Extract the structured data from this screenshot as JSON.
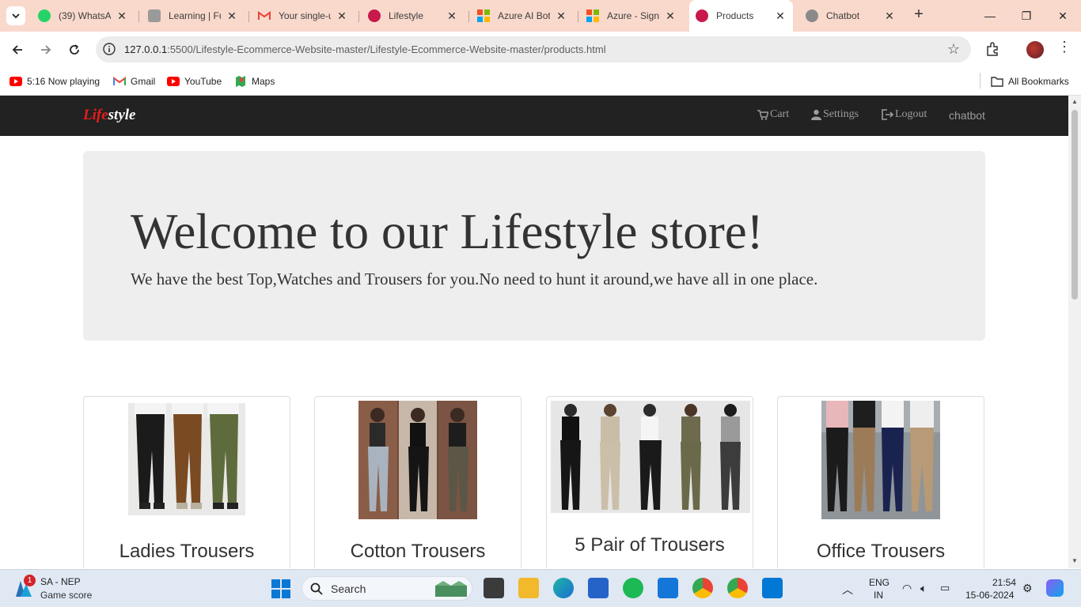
{
  "tabs": [
    {
      "title": "(39) WhatsApp",
      "icon": "whatsapp-icon",
      "color": "#25d366"
    },
    {
      "title": "Learning | Fu",
      "icon": "learning-icon",
      "color": "#8a8a8a"
    },
    {
      "title": "Your single-u",
      "icon": "gmail-icon",
      "color": "#ea4335"
    },
    {
      "title": "Lifestyle",
      "icon": "lifestyle-icon",
      "color": "#c9184a"
    },
    {
      "title": "Azure AI Bot",
      "icon": "microsoft-icon",
      "color": "#f25022"
    },
    {
      "title": "Azure - Sign",
      "icon": "microsoft-icon",
      "color": "#f25022"
    },
    {
      "title": "Products",
      "icon": "lifestyle-icon",
      "color": "#c9184a"
    },
    {
      "title": "Chatbot",
      "icon": "globe-icon",
      "color": "#777777"
    }
  ],
  "address": {
    "host": "127.0.0.1",
    "path": ":5500/Lifestyle-Ecommerce-Website-master/Lifestyle-Ecommerce-Website-master/products.html"
  },
  "bookmarks": {
    "items": [
      "5:16 Now playing",
      "Gmail",
      "YouTube",
      "Maps"
    ],
    "all": "All Bookmarks"
  },
  "site": {
    "brand_a": "Life",
    "brand_b": "style",
    "nav": [
      "Cart",
      "Settings",
      "Logout",
      "chatbot"
    ]
  },
  "hero": {
    "title": "Welcome to our Lifestyle store!",
    "subtitle": "We have the best Top,Watches and Trousers for you.No need to hunt it around,we have all in one place."
  },
  "products": [
    {
      "name": "Ladies Trousers"
    },
    {
      "name": "Cotton Trousers"
    },
    {
      "name": "5 Pair of Trousers"
    },
    {
      "name": "Office Trousers"
    }
  ],
  "taskbar": {
    "widget_badge": "1",
    "widget_title": "SA - NEP",
    "widget_sub": "Game score",
    "search": "Search",
    "lang1": "ENG",
    "lang2": "IN",
    "time": "21:54",
    "date": "15-06-2024"
  },
  "colors": {
    "accent_red": "#e81c1c",
    "navbar": "#222222",
    "tabstrip": "#f9d9cc"
  }
}
